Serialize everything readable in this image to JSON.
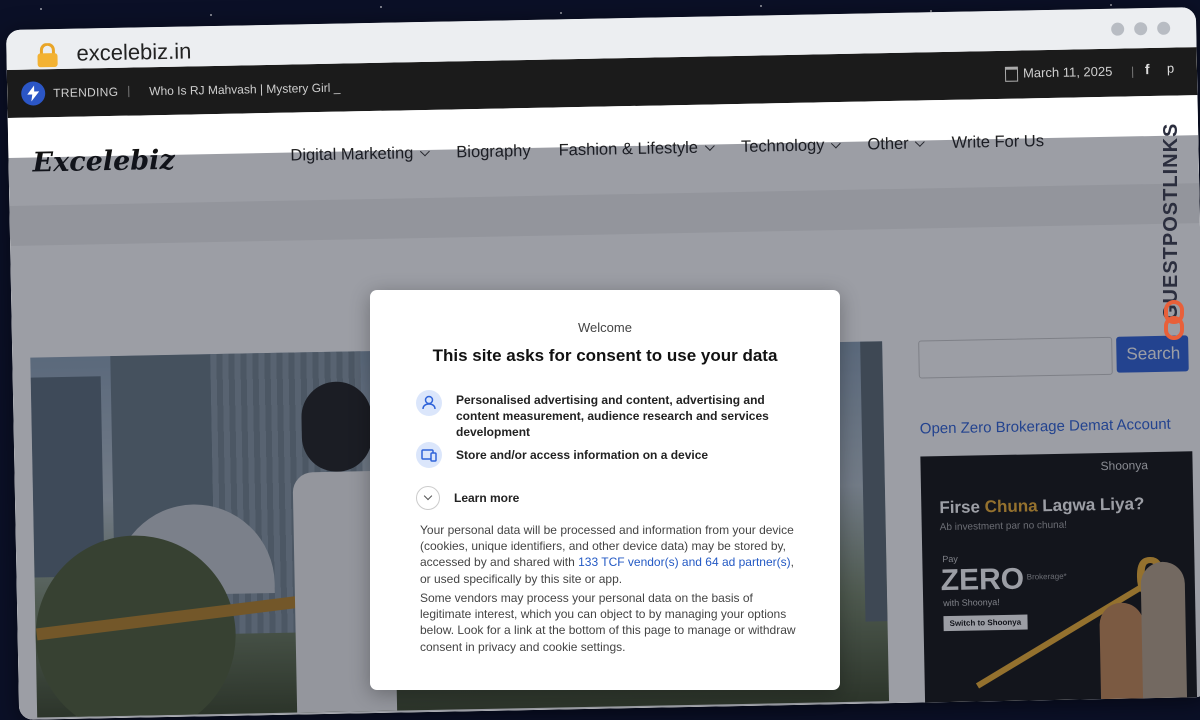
{
  "browser": {
    "url": "excelebiz.in"
  },
  "topbar": {
    "trending_label": "TRENDING",
    "separator": "|",
    "ticker_text": "Who Is RJ Mahvash | Mystery Girl _",
    "date": "March 11, 2025",
    "facebook_glyph": "f",
    "pinterest_glyph": "p"
  },
  "header": {
    "logo": "Excelebiz",
    "nav": [
      {
        "label": "Digital Marketing",
        "has_dropdown": true
      },
      {
        "label": "Biography",
        "has_dropdown": false
      },
      {
        "label": "Fashion & Lifestyle",
        "has_dropdown": true
      },
      {
        "label": "Technology",
        "has_dropdown": true
      },
      {
        "label": "Other",
        "has_dropdown": true
      },
      {
        "label": "Write For Us",
        "has_dropdown": false
      }
    ]
  },
  "sidebar": {
    "search_placeholder": "",
    "search_button": "Search",
    "link": "Open Zero Brokerage Demat Account",
    "ad": {
      "brand": "Shoonya",
      "headline_a": "Firse ",
      "headline_b": "Chuna",
      "headline_c": " Lagwa Liya?",
      "subline": "Ab investment par no chuna!",
      "pay": "Pay",
      "zero": "ZERO",
      "brokerage": "Brokerage*",
      "with": "with Shoonya!",
      "cta": "Switch to Shoonya",
      "big_zero": "0"
    }
  },
  "watermark": {
    "text": "GUESTPOSTLINKS"
  },
  "consent": {
    "welcome": "Welcome",
    "title": "This site asks for consent to use your data",
    "purposes": [
      {
        "icon": "person-icon",
        "text": "Personalised advertising and content, advertising and content measurement, audience research and services development"
      },
      {
        "icon": "devices-icon",
        "text": "Store and/or access information on a device"
      }
    ],
    "learn_more": "Learn more",
    "para1_a": "Your personal data will be processed and information from your device (cookies, unique identifiers, and other device data) may be stored by, accessed by and shared with ",
    "para1_link": "133 TCF vendor(s) and 64 ad partner(s)",
    "para1_b": ", or used specifically by this site or app.",
    "para2": "Some vendors may process your personal data on the basis of legitimate interest, which you can object to by managing your options below. Look for a link at the bottom of this page to manage or withdraw consent in privacy and cookie settings."
  },
  "colors": {
    "accent": "#2f63d9",
    "topbar_bg": "#1b1b1b",
    "ad_highlight": "#f2b233"
  }
}
